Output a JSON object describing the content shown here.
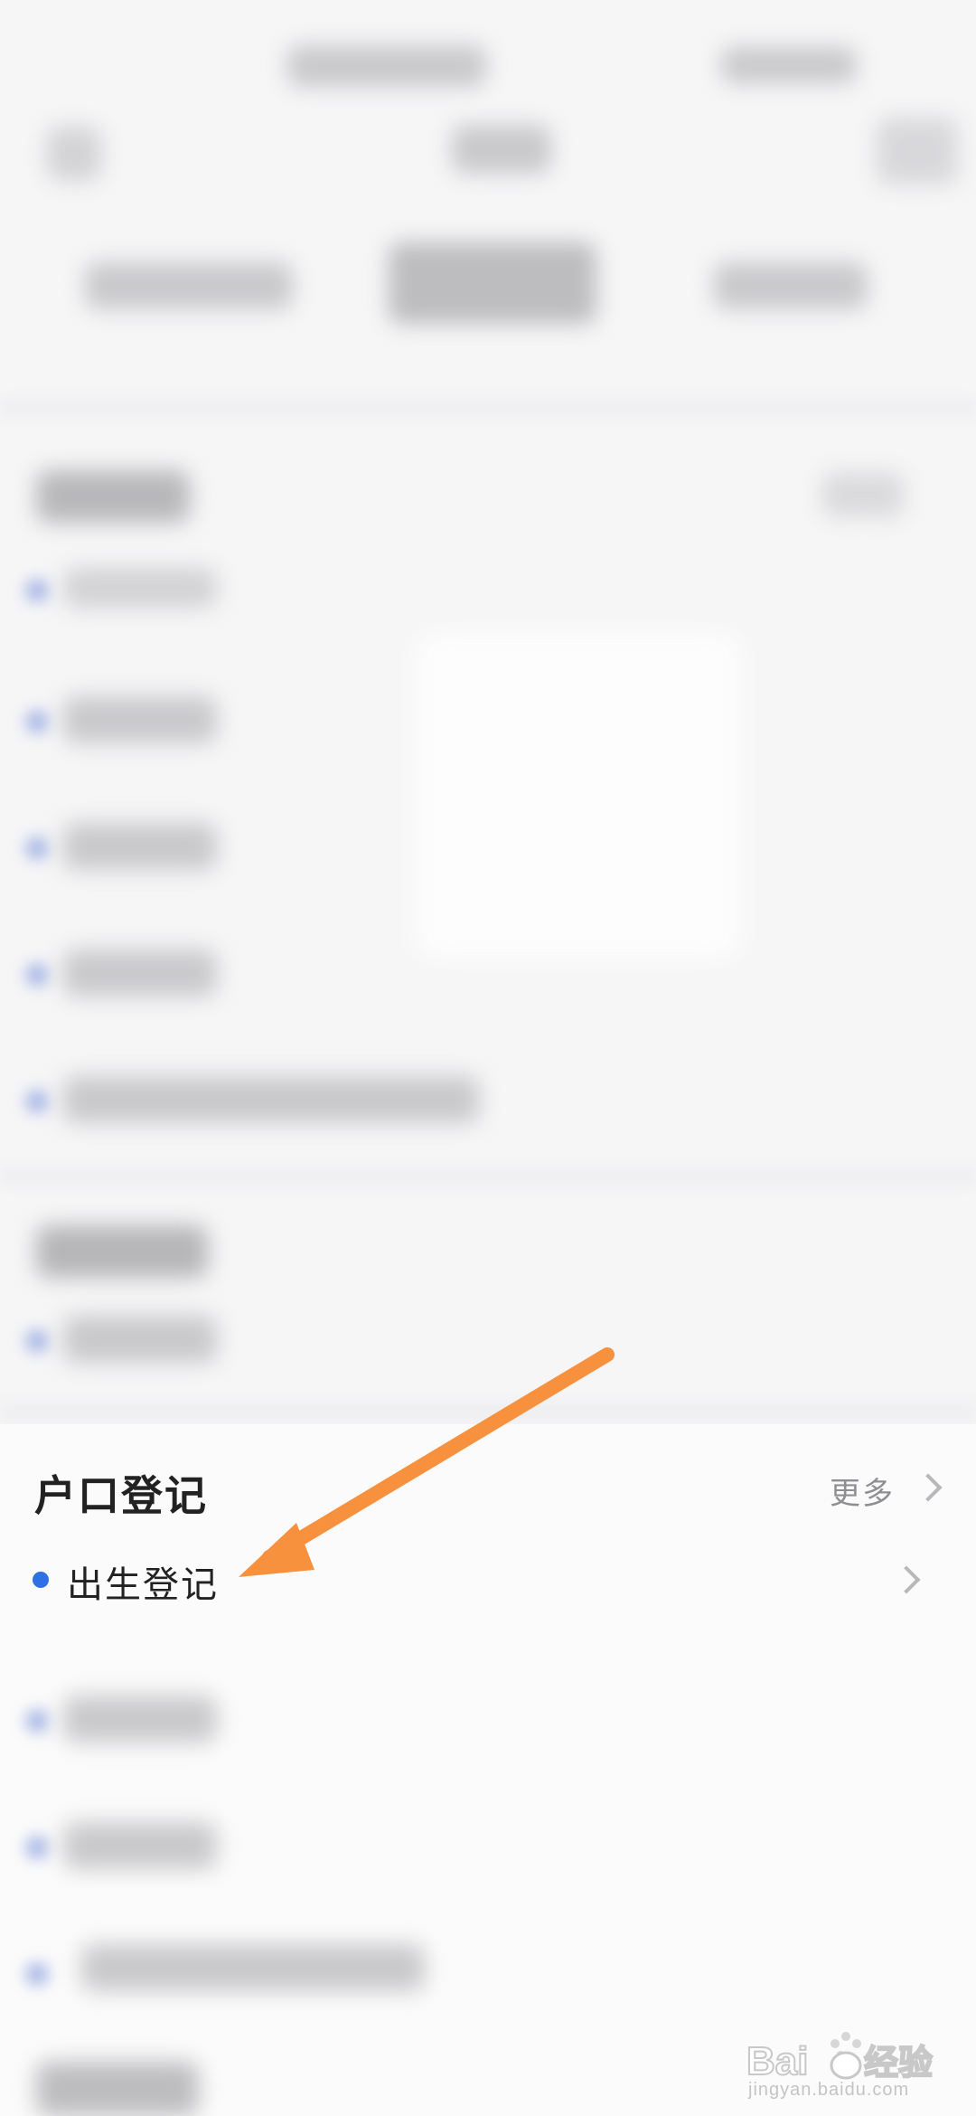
{
  "section": {
    "title": "户口登记",
    "more_label": "更多",
    "items": [
      {
        "label": "出生登记"
      }
    ]
  },
  "watermark": {
    "brand": "Baidu经验",
    "url": "jingyan.baidu.com"
  },
  "colors": {
    "accent": "#2f6fe4",
    "arrow": "#f7913d",
    "background": "#f6f6f7"
  },
  "icons": {
    "more_chevron": "chevron-right-icon",
    "item_chevron": "chevron-right-icon"
  }
}
